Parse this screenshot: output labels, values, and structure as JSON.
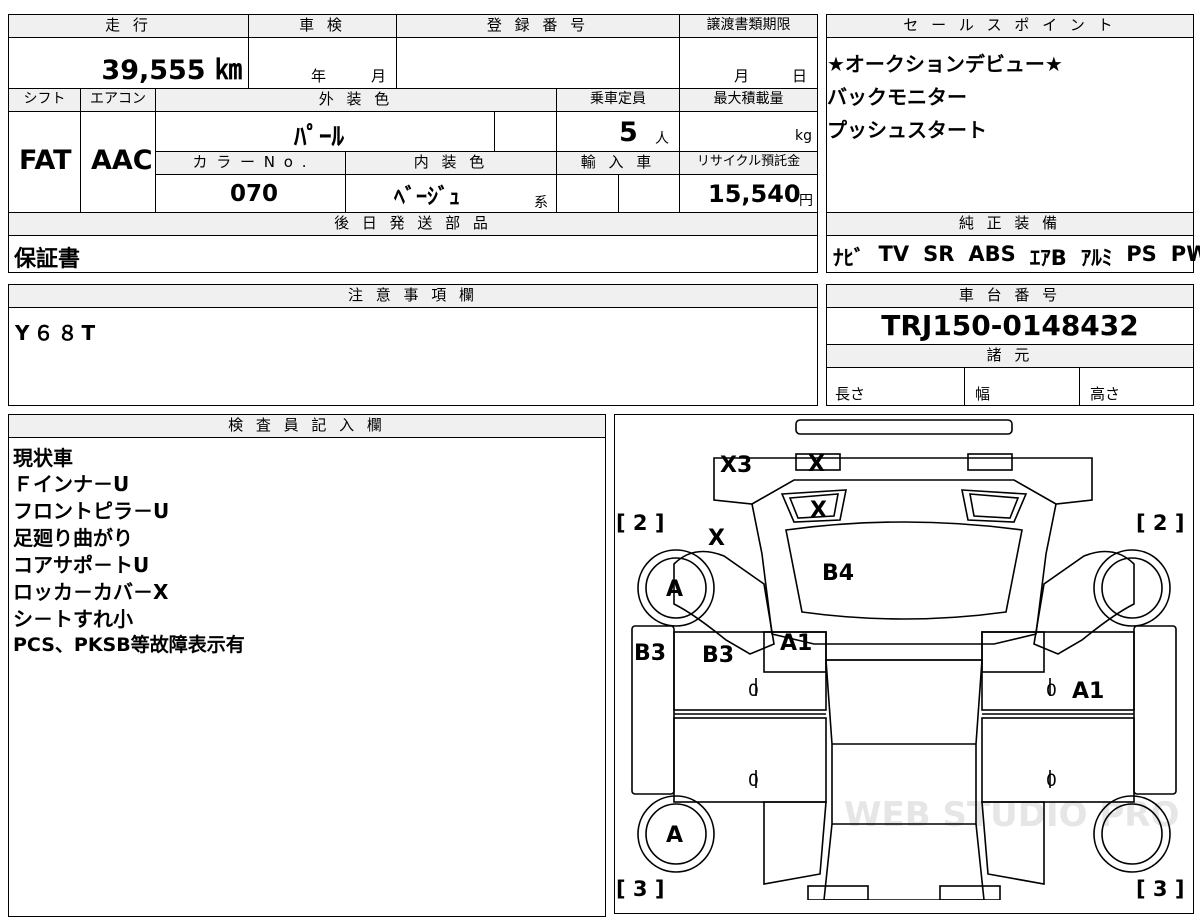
{
  "top_form": {
    "mileage_label": "走 行",
    "mileage_value": "39,555 ㎞",
    "inspection_label": "車 検",
    "inspection_year": "年",
    "inspection_month": "月",
    "registration_label": "登 録 番 号",
    "deadline_label": "譲渡書類期限",
    "deadline_month": "月",
    "deadline_day": "日",
    "shift_label": "シフト",
    "shift_value": "FAT",
    "aircon_label": "エアコン",
    "aircon_value": "AAC",
    "exterior_label": "外 装 色",
    "exterior_value": "ﾊﾟｰﾙ",
    "capacity_label": "乗車定員",
    "capacity_value": "5",
    "capacity_unit": "人",
    "maxload_label": "最大積載量",
    "maxload_unit": "kg",
    "colorno_label": "カ ラ ー N o .",
    "colorno_value": "070",
    "interior_label": "内 装 色",
    "interior_value": "ﾍﾞｰｼﾞｭ",
    "interior_suffix": "系",
    "import_label": "輸 入 車",
    "recycle_label": "リサイクル預託金",
    "recycle_value": "15,540",
    "recycle_unit": "円",
    "parts_label": "後 日 発 送 部 品",
    "parts_value": "保証書",
    "notes_label": "注 意 事 項 欄",
    "notes_value": "Y６８T"
  },
  "sales_points": {
    "label": "セ ー ル ス ポ イ ン ト",
    "items": [
      "★オークションデビュー★",
      "バックモニター",
      "プッシュスタート"
    ]
  },
  "equipment": {
    "label": "純 正 装 備",
    "items": [
      "ﾅﾋﾞ",
      "TV",
      "SR",
      "ABS",
      "ｴｱB",
      "ｱﾙﾐ",
      "PS",
      "PW"
    ]
  },
  "chassis": {
    "label": "車 台 番 号",
    "value": "TRJ150-0148432"
  },
  "specs": {
    "label": "諸 元",
    "length": "長さ",
    "width": "幅",
    "height": "高さ"
  },
  "inspector": {
    "label": "検 査 員 記 入 欄",
    "lines": [
      "現状車",
      "Ｆインナ－U",
      "フロントピラ－U",
      "足廻り曲がり",
      "コアサポ－トU",
      "ロッカ－カバ－X",
      "シ－トすれ小",
      "PCS、PKSB等故障表示有"
    ]
  },
  "diagram": {
    "marks": {
      "x3": "X3",
      "x_top": "X",
      "x_windshield": "X",
      "x_hood_left": "X",
      "b4": "B4",
      "a_front_left": "A",
      "b3_left_edge": "B3",
      "b3_left_door": "B3",
      "a1_pillar": "A1",
      "a1_right": "A1",
      "a_rear_left": "A",
      "zero_1": "0",
      "zero_2": "0",
      "zero_3": "0",
      "zero_4": "0"
    },
    "brackets": {
      "front_left": "[ 2 ]",
      "front_right": "[ 2 ]",
      "rear_left": "[ 3 ]",
      "rear_right": "[ 3 ]"
    },
    "watermark": "WEB STUDIO PRO"
  }
}
